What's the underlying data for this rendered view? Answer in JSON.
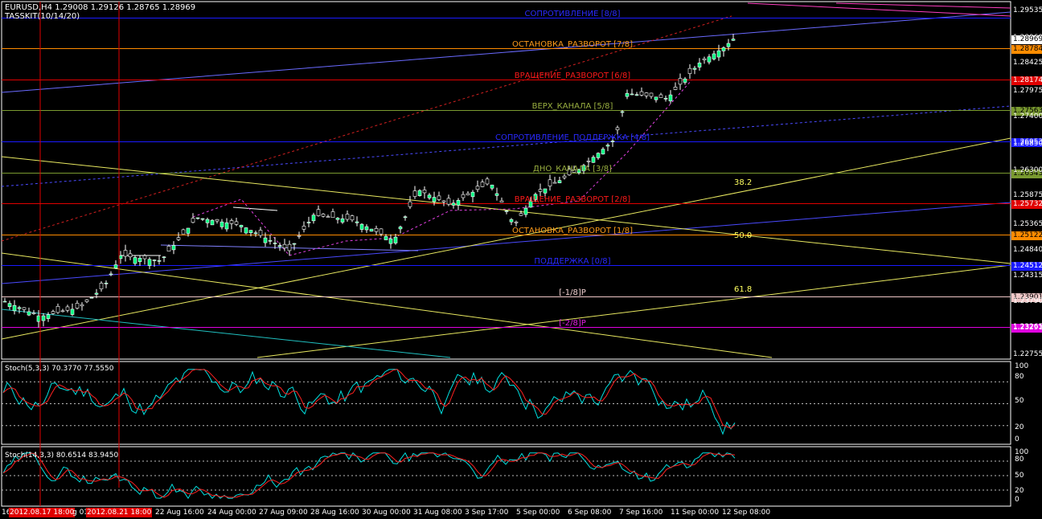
{
  "header": {
    "symbol_line": "EURUSD,H4  1.29008 1.29126 1.28765 1.28969",
    "indicator_line": "TASSKIT(10/14/20)"
  },
  "murrey_levels": [
    {
      "label": "СОПРОТИВЛЕНИЕ [8/8]",
      "price": 1.294,
      "color": "#1a1aff",
      "boxed": false,
      "box_text": "",
      "label_color": "#2a2aff"
    },
    {
      "label": "ОСТАНОВКА_РАЗВОРОТ [7/8]",
      "price": 1.28784,
      "color": "#ff8c00",
      "boxed": true,
      "box_text": "1.28784",
      "label_color": "#ff9c1a"
    },
    {
      "label": "ВРАЩЕНИЕ_РАЗВОРОТ [6/8]",
      "price": 1.28174,
      "color": "#e00000",
      "boxed": true,
      "box_text": "1.28174",
      "label_color": "#ff1a1a"
    },
    {
      "label": "ВЕРХ_КАНАЛА [5/8]",
      "price": 1.27563,
      "color": "#7a9a30",
      "boxed": true,
      "box_text": "1.27563",
      "label_color": "#9ab040"
    },
    {
      "label": "СОПРОТИВЛЕНИЕ_ПОДДЕРЖКА [4/8]",
      "price": 1.26953,
      "color": "#1a1aff",
      "boxed": true,
      "box_text": "1.26953",
      "label_color": "#2a2aff"
    },
    {
      "label": "ДНО_КАНАЛА [3/8]",
      "price": 1.26343,
      "color": "#7a9a30",
      "boxed": true,
      "box_text": "1.26343",
      "label_color": "#9ab040"
    },
    {
      "label": "ВРАЩЕНИЕ_РАЗВОРОТ [2/8]",
      "price": 1.25732,
      "color": "#e00000",
      "boxed": true,
      "box_text": "1.25732",
      "label_color": "#ff1a1a"
    },
    {
      "label": "ОСТАНОВКА_РАЗВОРОТ [1/8]",
      "price": 1.25122,
      "color": "#ff8c00",
      "boxed": true,
      "box_text": "1.25122",
      "label_color": "#ff9c1a"
    },
    {
      "label": "ПОДДЕРЖКА [0/8]",
      "price": 1.24512,
      "color": "#1a1aff",
      "boxed": true,
      "box_text": "1.24512",
      "label_color": "#2a2aff"
    },
    {
      "label": "[-1/8]P",
      "price": 1.23901,
      "color": "#f0c8c8",
      "boxed": true,
      "box_text": "1.23901",
      "label_color": "#f0d0d0"
    },
    {
      "label": "[-2/8]P",
      "price": 1.23291,
      "color": "#e000e0",
      "boxed": true,
      "box_text": "1.23291",
      "label_color": "#e020e0"
    }
  ],
  "price_axis": [
    "1.29535",
    "1.28969",
    "1.28425",
    "1.27975",
    "1.27400",
    "1.26850",
    "1.26300",
    "1.25875",
    "1.25365",
    "1.24840",
    "1.24315",
    "1.23790",
    "1.23265",
    "1.22755"
  ],
  "fib_labels": [
    "38.2",
    "50.0",
    "61.8"
  ],
  "current_price_box": "1.28969",
  "stoch1": {
    "label": "Stoch(5,3,3) 70.3770 77.5550",
    "levels": [
      "100",
      "80",
      "50",
      "20",
      "0"
    ]
  },
  "stoch2": {
    "label": "Stoch(14,3,3) 80.6514 83.9450",
    "levels": [
      "100",
      "80",
      "50",
      "20",
      "0"
    ]
  },
  "time_axis": {
    "labels": [
      "22 Aug 16:00",
      "24 Aug 00:00",
      "27 Aug 09:00",
      "28 Aug 16:00",
      "30 Aug 00:00",
      "31 Aug 08:00",
      "3 Sep 17:00",
      "5 Sep 00:00",
      "6 Sep 08:00",
      "7 Sep 16:00",
      "11 Sep 00:00",
      "12 Sep 08:00"
    ],
    "left_fragment_1": "16",
    "left_fragment_2": "g 01",
    "marker_1": "2012.08.17 18:00",
    "marker_2": "2012.08.21 18:00"
  },
  "colors": {
    "bull_candle": "#00ff80",
    "bear_candle": "#000000",
    "candle_outline": "#ffffff",
    "stoch_main": "#00e0e0",
    "stoch_signal": "#ff2020"
  }
}
